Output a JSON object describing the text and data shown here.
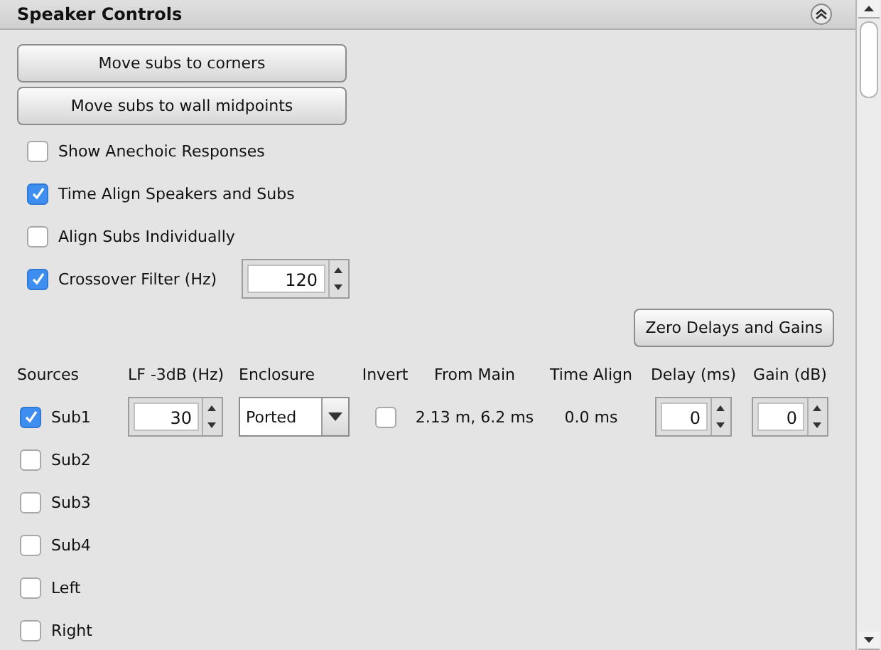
{
  "panel": {
    "title": "Speaker Controls"
  },
  "buttons": [
    "Move subs to corners",
    "Move subs to wall midpoints"
  ],
  "options": [
    {
      "label": "Show Anechoic Responses",
      "checked": false
    },
    {
      "label": "Time Align Speakers and Subs",
      "checked": true
    },
    {
      "label": "Align Subs Individually",
      "checked": false
    },
    {
      "label": "Crossover Filter (Hz)",
      "checked": true,
      "value": "120"
    }
  ],
  "zero_button": "Zero Delays and Gains",
  "columns": [
    "Sources",
    "LF -3dB (Hz)",
    "Enclosure",
    "Invert",
    "From Main",
    "Time Align",
    "Delay (ms)",
    "Gain (dB)"
  ],
  "sources": [
    {
      "kind": "controls",
      "name": "Sub1",
      "checked": true,
      "lf": "30",
      "enclosure": "Ported",
      "invert": false,
      "from_main": "2.13 m, 6.2 ms",
      "time_align": "0.0 ms",
      "delay": "0",
      "gain": "0"
    },
    {
      "kind": "label",
      "name": "Sub2",
      "checked": false
    },
    {
      "kind": "label",
      "name": "Sub3",
      "checked": false
    },
    {
      "kind": "label",
      "name": "Sub4",
      "checked": false
    },
    {
      "kind": "label",
      "name": "Left",
      "checked": false
    },
    {
      "kind": "label",
      "name": "Right",
      "checked": false
    }
  ]
}
